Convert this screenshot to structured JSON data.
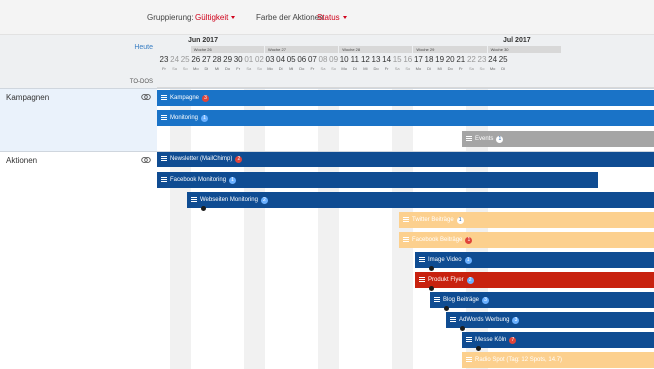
{
  "toolbar": {
    "group_label": "Gruppierung:",
    "group_value": "Gültigkeit",
    "color_label": "Farbe der Aktionen",
    "color_value": "Status"
  },
  "header": {
    "today": "Heute",
    "todos": "TO-DOS",
    "months": [
      "Jun 2017",
      "Jul 2017"
    ],
    "weeks": [
      "Woche 26",
      "Woche 27",
      "Woche 28",
      "Woche 29",
      "Woche 30"
    ],
    "days": [
      "23",
      "24",
      "25",
      "26",
      "27",
      "28",
      "29",
      "30",
      "01",
      "02",
      "03",
      "04",
      "05",
      "06",
      "07",
      "08",
      "09",
      "10",
      "11",
      "12",
      "13",
      "14",
      "15",
      "16",
      "17",
      "18",
      "19",
      "20",
      "21",
      "22",
      "23",
      "24",
      "25"
    ],
    "daynames": [
      "Fr",
      "Sa",
      "So",
      "Mo",
      "Di",
      "Mi",
      "Do",
      "Fr",
      "Sa",
      "So",
      "Mo",
      "Di",
      "Mi",
      "Do",
      "Fr",
      "Sa",
      "So",
      "Mo",
      "Di",
      "Mi",
      "Do",
      "Fr",
      "Sa",
      "So",
      "Mo",
      "Di",
      "Mi",
      "Do",
      "Fr",
      "Sa",
      "So",
      "Mo",
      "Di"
    ]
  },
  "sections": [
    {
      "label": "Kampagnen",
      "icon": "link-icon"
    },
    {
      "label": "Aktionen",
      "icon": "link-icon"
    }
  ],
  "bars": [
    {
      "label": "Kampagne",
      "badge": "3",
      "badge_style": "red",
      "color": "#1a73c7",
      "dot": false
    },
    {
      "label": "Monitoring",
      "badge": "1",
      "badge_style": "blue",
      "color": "#1a73c7",
      "dot": false
    },
    {
      "label": "Events",
      "badge": "1",
      "badge_style": "white",
      "color": "#a5a5a5",
      "dot": false
    },
    {
      "label": "Newsletter (MailChimp)",
      "badge": "2",
      "badge_style": "red",
      "color": "#0f4c92",
      "dot": false
    },
    {
      "label": "Facebook Monitoring",
      "badge": "1",
      "badge_style": "blue",
      "color": "#0f4c92",
      "dot": false
    },
    {
      "label": "Webseiten Monitoring",
      "badge": "2",
      "badge_style": "blue",
      "color": "#0f4c92",
      "dot": true
    },
    {
      "label": "Twitter Beiträge",
      "badge": "1",
      "badge_style": "white",
      "color": "#fcd08e",
      "dot": false
    },
    {
      "label": "Facebook Beiträge",
      "badge": "1",
      "badge_style": "red",
      "color": "#fcd08e",
      "dot": false
    },
    {
      "label": "Image Video",
      "badge": "1",
      "badge_style": "blue",
      "color": "#0f4c92",
      "dot": true
    },
    {
      "label": "Produkt Flyer",
      "badge": "2",
      "badge_style": "blue",
      "color": "#c8220f",
      "dot": true
    },
    {
      "label": "Blog Beiträge",
      "badge": "3",
      "badge_style": "blue",
      "color": "#0f4c92",
      "dot": true
    },
    {
      "label": "AdWords Werbung",
      "badge": "3",
      "badge_style": "blue",
      "color": "#0f4c92",
      "dot": true
    },
    {
      "label": "Messe Köln",
      "badge": "7",
      "badge_style": "red",
      "color": "#0f4c92",
      "dot": true
    },
    {
      "label": "Radio Spot (Tag: 12 Spots, 14.7)",
      "badge": "",
      "badge_style": "blue",
      "color": "#fcd08e",
      "dot": false
    }
  ]
}
